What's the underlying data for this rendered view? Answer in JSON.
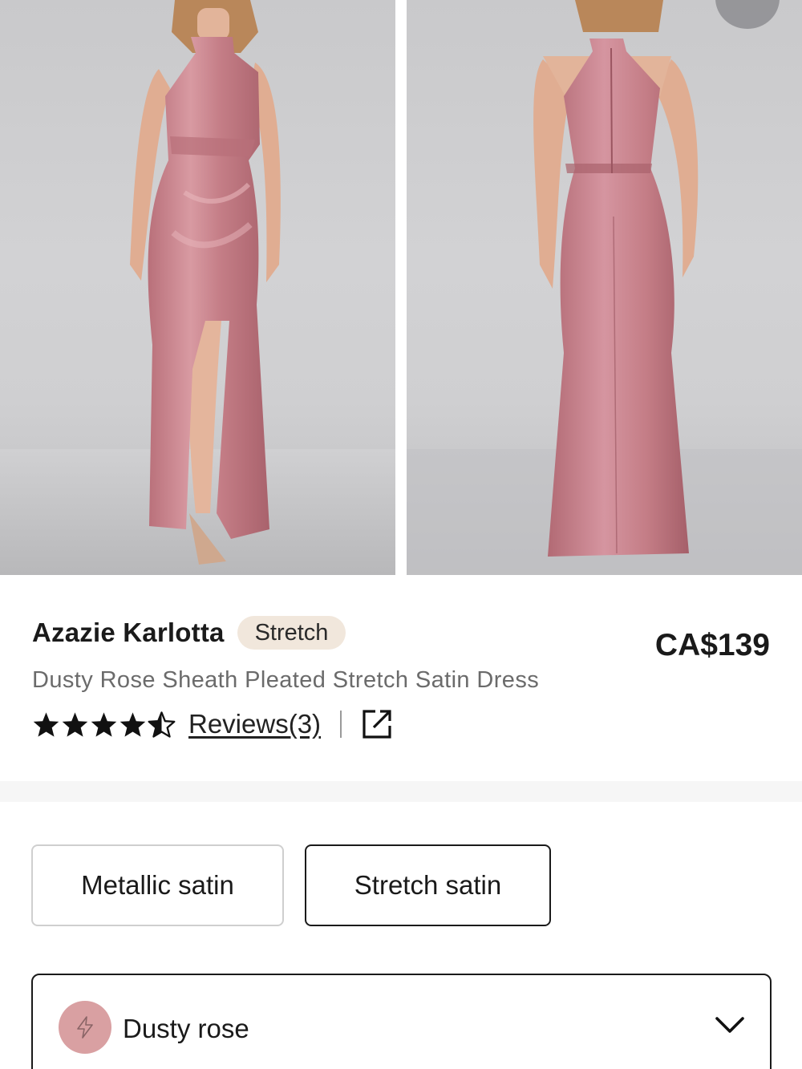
{
  "product": {
    "brand_name": "Azazie Karlotta",
    "tag": "Stretch",
    "price": "CA$139",
    "subtitle": "Dusty Rose Sheath Pleated Stretch Satin Dress",
    "rating": 4.5,
    "rating_max": 5,
    "reviews_label": "Reviews(3)"
  },
  "fabric_options": [
    {
      "label": "Metallic satin",
      "selected": false
    },
    {
      "label": "Stretch satin",
      "selected": true
    }
  ],
  "color_select": {
    "value": "Dusty rose",
    "swatch_color": "#d9a0a2"
  },
  "colors": {
    "dress": "#c47d86",
    "tag_bg": "#f1e7dc",
    "text": "#1a1a1a",
    "muted": "#6b6b6b"
  },
  "icons": [
    "heart-icon",
    "star-icon",
    "star-half-icon",
    "external-link-icon",
    "lightning-icon",
    "chevron-down-icon"
  ]
}
